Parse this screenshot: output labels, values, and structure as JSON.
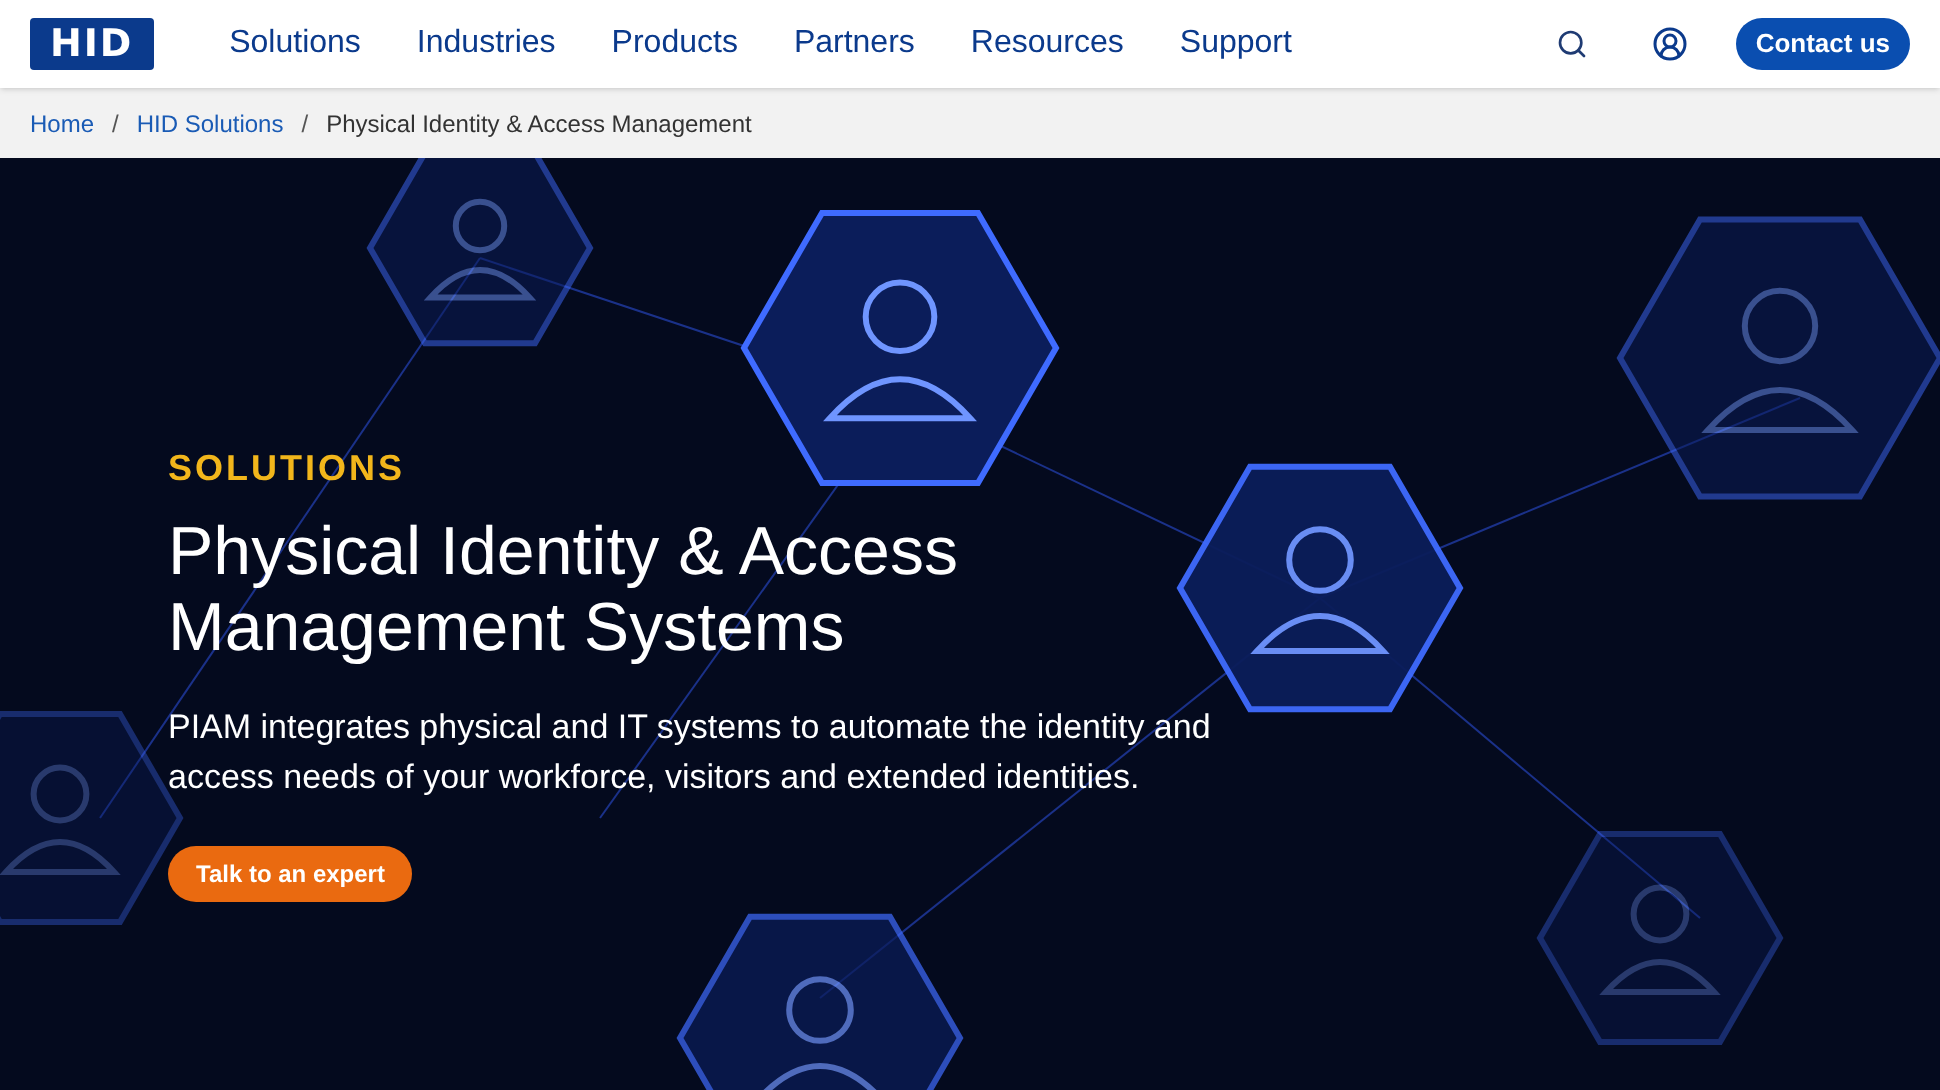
{
  "header": {
    "logo": "HID",
    "nav": [
      "Solutions",
      "Industries",
      "Products",
      "Partners",
      "Resources",
      "Support"
    ],
    "contact_button": "Contact us"
  },
  "breadcrumb_separator": "/",
  "breadcrumb": [
    {
      "label": "Home",
      "link": true
    },
    {
      "label": "HID Solutions",
      "link": true
    },
    {
      "label": "Physical Identity & Access Management",
      "link": false
    }
  ],
  "hero": {
    "eyebrow": "SOLUTIONS",
    "title": "Physical Identity & Access Management Systems",
    "description": "PIAM integrates physical and IT systems to automate the identity and access needs of your workforce, visitors and extended identities.",
    "cta": "Talk to an expert"
  }
}
